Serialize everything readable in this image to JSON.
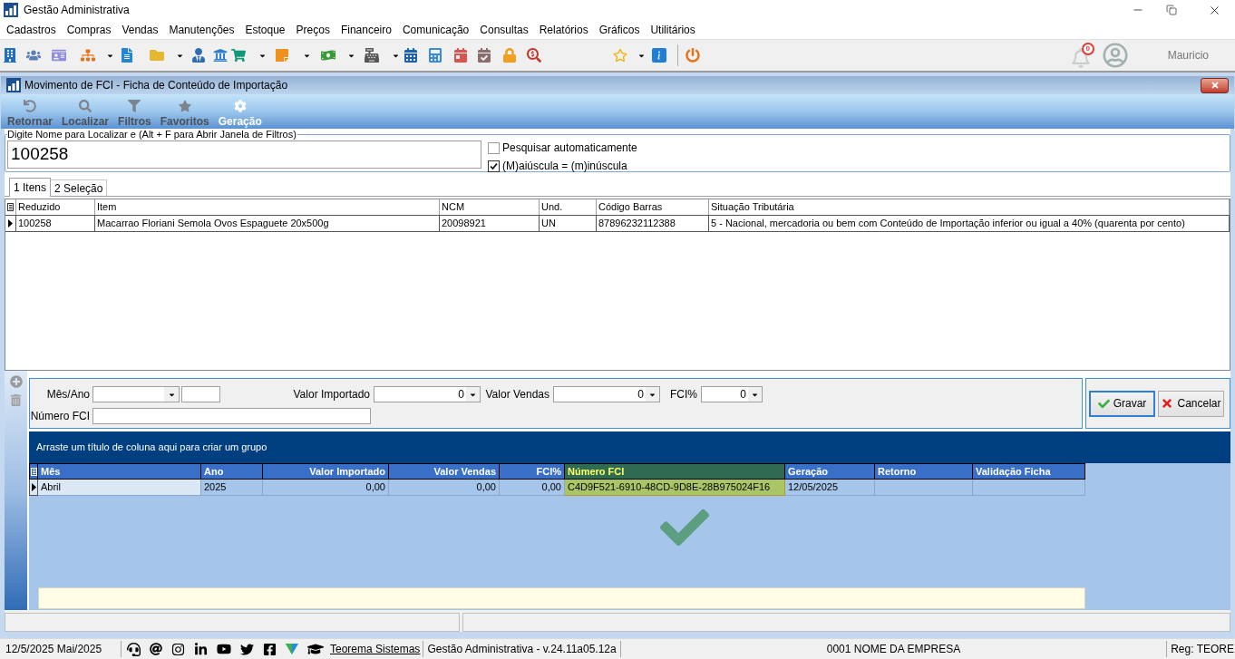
{
  "window": {
    "title": "Gestão Administrativa"
  },
  "menu": [
    "Cadastros",
    "Compras",
    "Vendas",
    "Manutenções",
    "Estoque",
    "Preços",
    "Financeiro",
    "Comunicação",
    "Consultas",
    "Relatórios",
    "Gráficos",
    "Utilitários"
  ],
  "user_bar": {
    "notification_count": "0",
    "user_name": "Mauricio"
  },
  "child_window": {
    "title": "Movimento de FCI - Ficha de Conteúdo de Importação",
    "ribbon": [
      {
        "label": "Retornar",
        "kind": "back",
        "disabled": true
      },
      {
        "label": "Localizar",
        "kind": "find",
        "disabled": true
      },
      {
        "label": "Filtros",
        "kind": "filter",
        "disabled": true
      },
      {
        "label": "Favoritos",
        "kind": "favorite",
        "disabled": true
      },
      {
        "label": "Geração",
        "kind": "generate",
        "disabled": false
      }
    ],
    "search": {
      "legend": "Digite Nome para Localizar e (Alt + F para Abrir Janela de Filtros)",
      "value": "100258",
      "options": [
        {
          "label": "Pesquisar automaticamente",
          "checked": false
        },
        {
          "label": "(M)aiúscula = (m)inúscula",
          "checked": true
        }
      ]
    },
    "tabs": [
      {
        "label": "1 Itens",
        "selected": true
      },
      {
        "label": "2 Seleção",
        "selected": false
      }
    ],
    "items_table": {
      "columns": [
        "Reduzido",
        "Item",
        "NCM",
        "Und.",
        "Código Barras",
        "Situação Tributária"
      ],
      "rows": [
        {
          "selected": true,
          "cells": [
            "100258",
            "Macarrao Floriani Semola Ovos Espaguete 20x500g",
            "20098921",
            "UN",
            "87896232112388",
            "5 - Nacional, mercadoria ou bem com Conteúdo de Importação inferior ou igual a 40% (quarenta por cento)"
          ]
        }
      ]
    },
    "entry_form": {
      "rows": [
        [
          {
            "label": "Mês/Ano",
            "kind": "month_year"
          },
          {
            "label": "Valor Importado",
            "kind": "number",
            "value": "0"
          },
          {
            "label": "Valor Vendas",
            "kind": "number",
            "value": "0"
          },
          {
            "label": "FCI%",
            "kind": "number",
            "value": "0"
          }
        ],
        [
          {
            "label": "Número FCI",
            "kind": "text"
          }
        ]
      ],
      "buttons": [
        {
          "label": "Gravar",
          "kind": "confirm",
          "focused": true
        },
        {
          "label": "Cancelar",
          "kind": "cancel",
          "focused": false
        }
      ]
    },
    "fci_table": {
      "group_panel_text": "Arraste um título de coluna aqui para criar um grupo",
      "columns": [
        {
          "label": "Mês",
          "kind": "text",
          "selected": false
        },
        {
          "label": "Ano",
          "kind": "text",
          "selected": false
        },
        {
          "label": "Valor Importado",
          "kind": "numeric",
          "selected": false
        },
        {
          "label": "Valor Vendas",
          "kind": "numeric",
          "selected": false
        },
        {
          "label": "FCI%",
          "kind": "numeric",
          "selected": false
        },
        {
          "label": "Número FCI",
          "kind": "text",
          "selected": true
        },
        {
          "label": "Geração",
          "kind": "text",
          "selected": false
        },
        {
          "label": "Retorno",
          "kind": "text",
          "selected": false
        },
        {
          "label": "Validação Ficha",
          "kind": "text",
          "selected": false
        }
      ],
      "rows": [
        {
          "selected": true,
          "cells": [
            "Abril",
            "2025",
            "0,00",
            "0,00",
            "0,00",
            "C4D9F521-6910-48CD-9D8E-28B975024F16",
            "12/05/2025"
          ]
        }
      ]
    }
  },
  "status_bar": {
    "date": "12/5/2025 Mai/2025",
    "link": "Teorema Sistemas",
    "version": "Gestão Administrativa - v.24.11a05.12a",
    "company": "0001 NOME DA EMPRESA",
    "registration": "Reg: TEORE"
  }
}
